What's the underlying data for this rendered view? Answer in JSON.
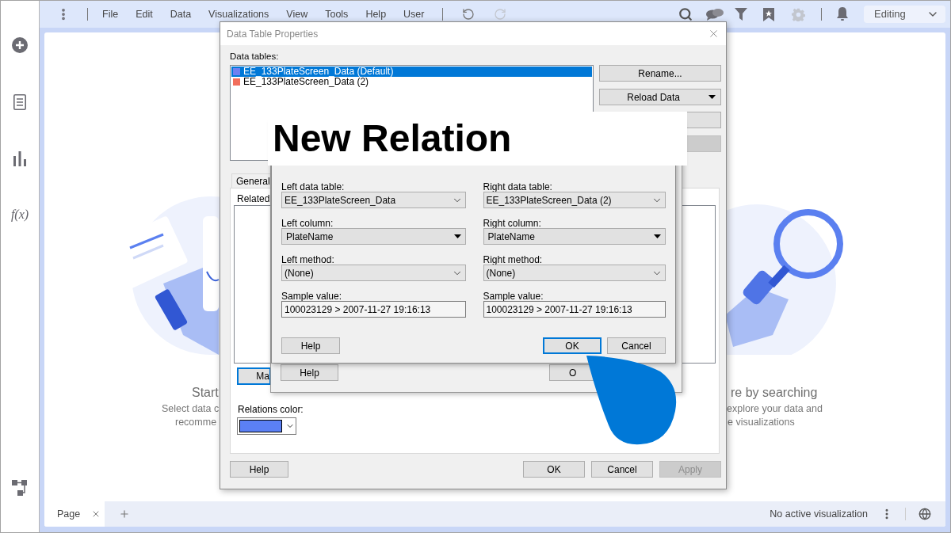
{
  "top_bar": {
    "menu": [
      "File",
      "Edit",
      "Data",
      "Visualizations",
      "View",
      "Tools",
      "Help",
      "User"
    ],
    "mode": "Editing"
  },
  "sidebar": {
    "formula": "f(x)"
  },
  "start_panel": {
    "left_title": "Start",
    "left_lines": [
      "Select data c",
      "recomme"
    ],
    "right_title": "re by searching",
    "right_lines": [
      "explore your data and",
      "e visualizations"
    ]
  },
  "page_tabs": [
    {
      "label": "Page",
      "selected": true
    }
  ],
  "status_bar": {
    "text": "No active visualization"
  },
  "data_table_properties": {
    "title": "Data Table Properties",
    "list_label": "Data tables:",
    "tables": [
      {
        "name": "EE_133PlateScreen_Data (Default)",
        "color": "#6f80f2",
        "selected": true
      },
      {
        "name": "EE_133PlateScreen_Data (2)",
        "color": "#f26e5c",
        "selected": false
      }
    ],
    "rename": "Rename...",
    "reload": "Reload Data",
    "tabs": [
      {
        "label": "General",
        "selected": false
      }
    ],
    "related_label": "Related",
    "manage_button": "Ma",
    "relations_color_label": "Relations color:",
    "footer": {
      "help": "Help",
      "ok": "OK",
      "cancel": "Cancel",
      "apply": "Apply",
      "apply_disabled": true
    }
  },
  "relations_dialog": {
    "help": "Help",
    "ok": "O"
  },
  "banner": {
    "text": "New Relation"
  },
  "new_relation": {
    "left": [
      {
        "label": "Left data table:",
        "value": "EE_133PlateScreen_Data",
        "kind": "combo"
      },
      {
        "label": "Left column:",
        "value": "PlateName",
        "kind": "dropdown"
      },
      {
        "label": "Left method:",
        "value": "(None)",
        "kind": "combo"
      },
      {
        "label": "Sample value:",
        "value": "100023129 > 2007-11-27 19:16:13",
        "kind": "text"
      }
    ],
    "right": [
      {
        "label": "Right data table:",
        "value": "EE_133PlateScreen_Data (2)",
        "kind": "combo"
      },
      {
        "label": "Right column:",
        "value": "PlateName",
        "kind": "dropdown"
      },
      {
        "label": "Right method:",
        "value": "(None)",
        "kind": "combo"
      },
      {
        "label": "Sample value:",
        "value": "100023129 > 2007-11-27 19:16:13",
        "kind": "text"
      }
    ],
    "help": "Help",
    "ok": "OK",
    "cancel": "Cancel"
  }
}
